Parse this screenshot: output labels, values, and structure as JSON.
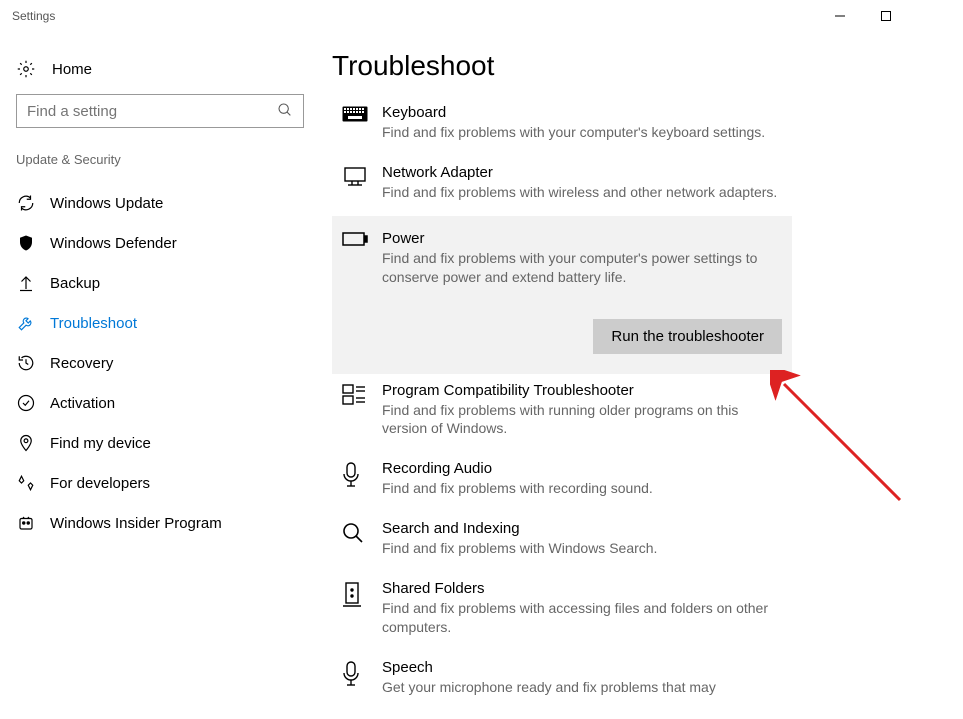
{
  "window": {
    "title": "Settings"
  },
  "sidebar": {
    "home": "Home",
    "search_placeholder": "Find a setting",
    "section": "Update & Security",
    "items": [
      {
        "label": "Windows Update"
      },
      {
        "label": "Windows Defender"
      },
      {
        "label": "Backup"
      },
      {
        "label": "Troubleshoot"
      },
      {
        "label": "Recovery"
      },
      {
        "label": "Activation"
      },
      {
        "label": "Find my device"
      },
      {
        "label": "For developers"
      },
      {
        "label": "Windows Insider Program"
      }
    ]
  },
  "main": {
    "title": "Troubleshoot",
    "run_button": "Run the troubleshooter",
    "items": [
      {
        "title": "Keyboard",
        "desc": "Find and fix problems with your computer's keyboard settings."
      },
      {
        "title": "Network Adapter",
        "desc": "Find and fix problems with wireless and other network adapters."
      },
      {
        "title": "Power",
        "desc": "Find and fix problems with your computer's power settings to conserve power and extend battery life."
      },
      {
        "title": "Program Compatibility Troubleshooter",
        "desc": "Find and fix problems with running older programs on this version of Windows."
      },
      {
        "title": "Recording Audio",
        "desc": "Find and fix problems with recording sound."
      },
      {
        "title": "Search and Indexing",
        "desc": "Find and fix problems with Windows Search."
      },
      {
        "title": "Shared Folders",
        "desc": "Find and fix problems with accessing files and folders on other computers."
      },
      {
        "title": "Speech",
        "desc": "Get your microphone ready and fix problems that may"
      }
    ]
  }
}
